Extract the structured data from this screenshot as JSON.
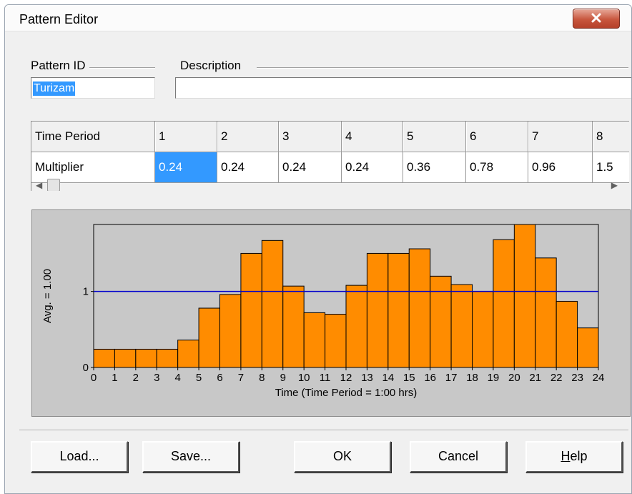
{
  "window": {
    "title": "Pattern Editor"
  },
  "pattern": {
    "id_label": "Pattern ID",
    "id_value": "Turizam",
    "description_label": "Description",
    "description_value": ""
  },
  "grid": {
    "row_headers": [
      "Time Period",
      "Multiplier"
    ],
    "periods": [
      "1",
      "2",
      "3",
      "4",
      "5",
      "6",
      "7",
      "8"
    ],
    "multipliers": [
      "0.24",
      "0.24",
      "0.24",
      "0.24",
      "0.36",
      "0.78",
      "0.96",
      "1.5"
    ]
  },
  "chart_data": {
    "type": "bar",
    "xlabel": "Time (Time Period = 1:00 hrs)",
    "ylabel": "Avg. = 1.00",
    "x_ticks": [
      "0",
      "1",
      "2",
      "3",
      "4",
      "5",
      "6",
      "7",
      "8",
      "9",
      "10",
      "11",
      "12",
      "13",
      "14",
      "15",
      "16",
      "17",
      "18",
      "19",
      "20",
      "21",
      "22",
      "23",
      "24"
    ],
    "y_ticks": [
      "0",
      "1"
    ],
    "values": [
      0.24,
      0.24,
      0.24,
      0.24,
      0.36,
      0.78,
      0.96,
      1.5,
      1.67,
      1.07,
      0.72,
      0.7,
      1.08,
      1.5,
      1.5,
      1.56,
      1.2,
      1.09,
      1.0,
      1.68,
      1.88,
      1.44,
      0.87,
      0.52
    ],
    "average": 1.0,
    "ylim": [
      0,
      1.88
    ],
    "bar_color": "#ff8c00",
    "average_line_color": "#0000cc",
    "background_color": "#c8c8c8"
  },
  "buttons": {
    "load": "Load...",
    "save": "Save...",
    "ok": "OK",
    "cancel": "Cancel",
    "help": "Help"
  }
}
